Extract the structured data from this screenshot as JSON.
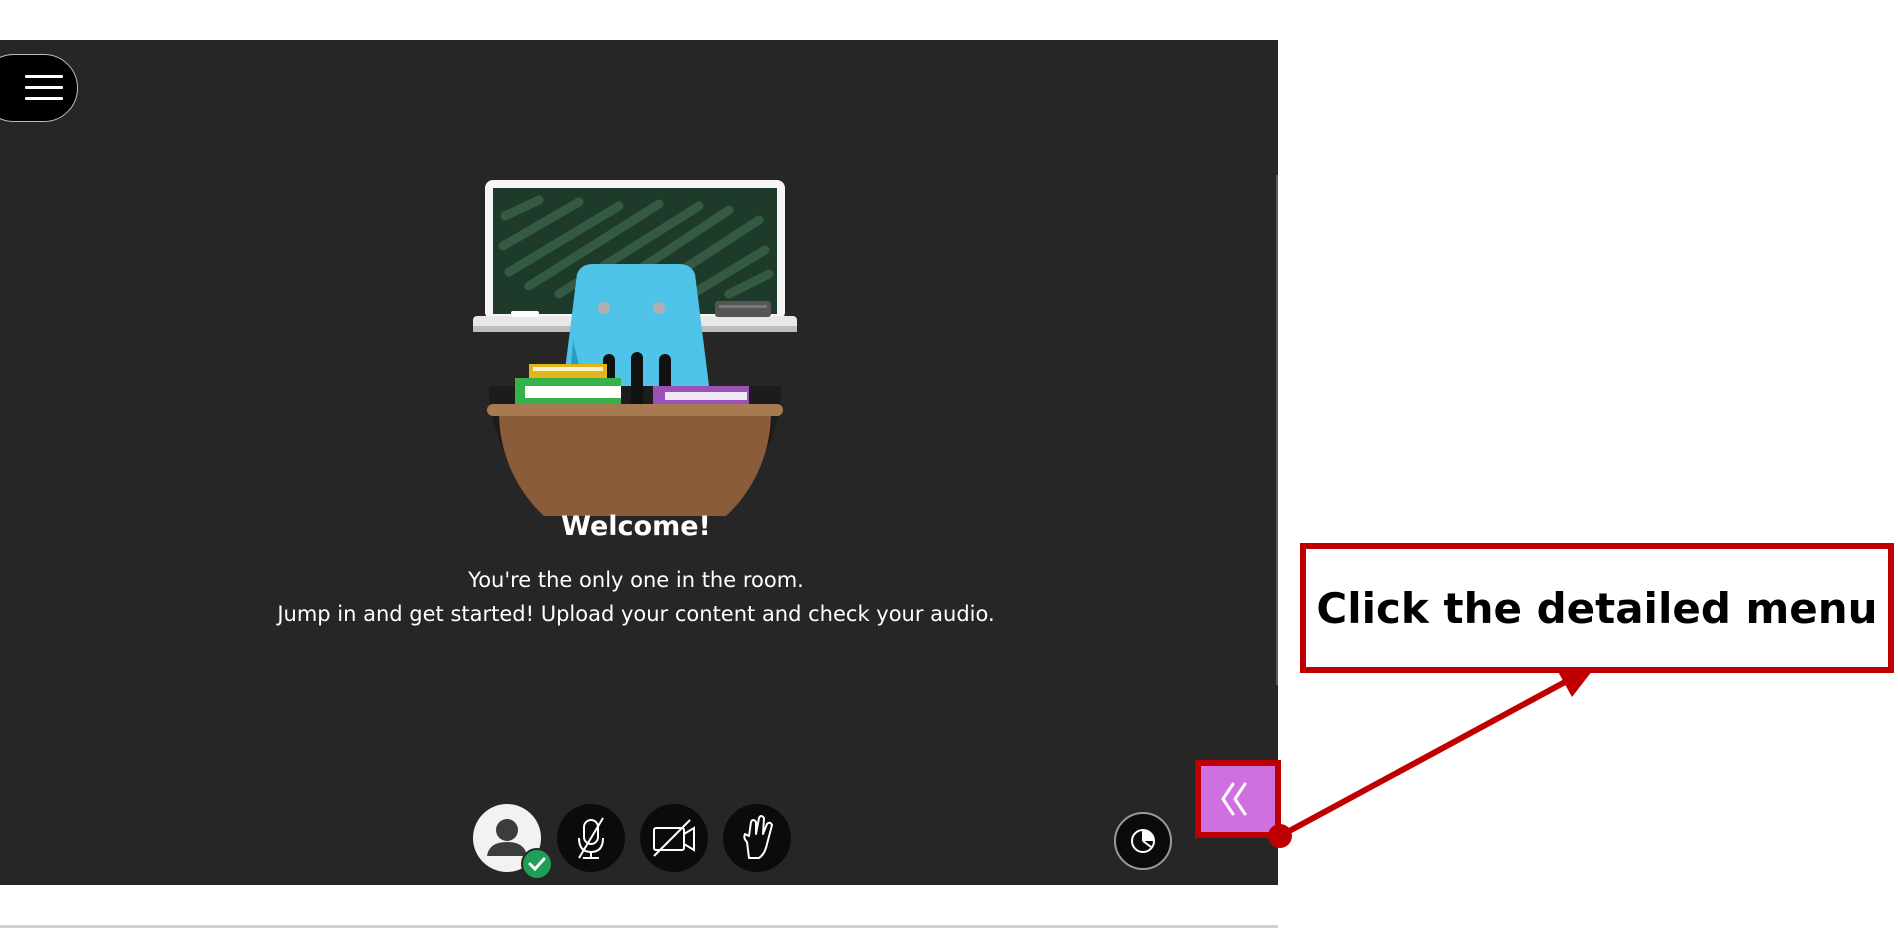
{
  "menu": {
    "icon": "hamburger-menu-icon"
  },
  "welcome": {
    "title": "Welcome!",
    "line1": "You're the only one in the room.",
    "line2": "Jump in and get started! Upload your content and check your audio."
  },
  "controls": [
    {
      "name": "avatar-status-button",
      "icon": "user-avatar-icon",
      "badge": "check-icon"
    },
    {
      "name": "microphone-button",
      "icon": "microphone-off-icon"
    },
    {
      "name": "camera-button",
      "icon": "camera-off-icon"
    },
    {
      "name": "raise-hand-button",
      "icon": "hand-icon"
    }
  ],
  "share": {
    "icon": "share-content-icon"
  },
  "collaborate": {
    "icon": "double-chevron-left-icon"
  },
  "annotation": {
    "text": "Click the detailed menu"
  },
  "colors": {
    "app_background": "#262626",
    "callout_red": "#c00000",
    "collaborate_purple": "#cf6fe0",
    "badge_green": "#1f9e57"
  }
}
